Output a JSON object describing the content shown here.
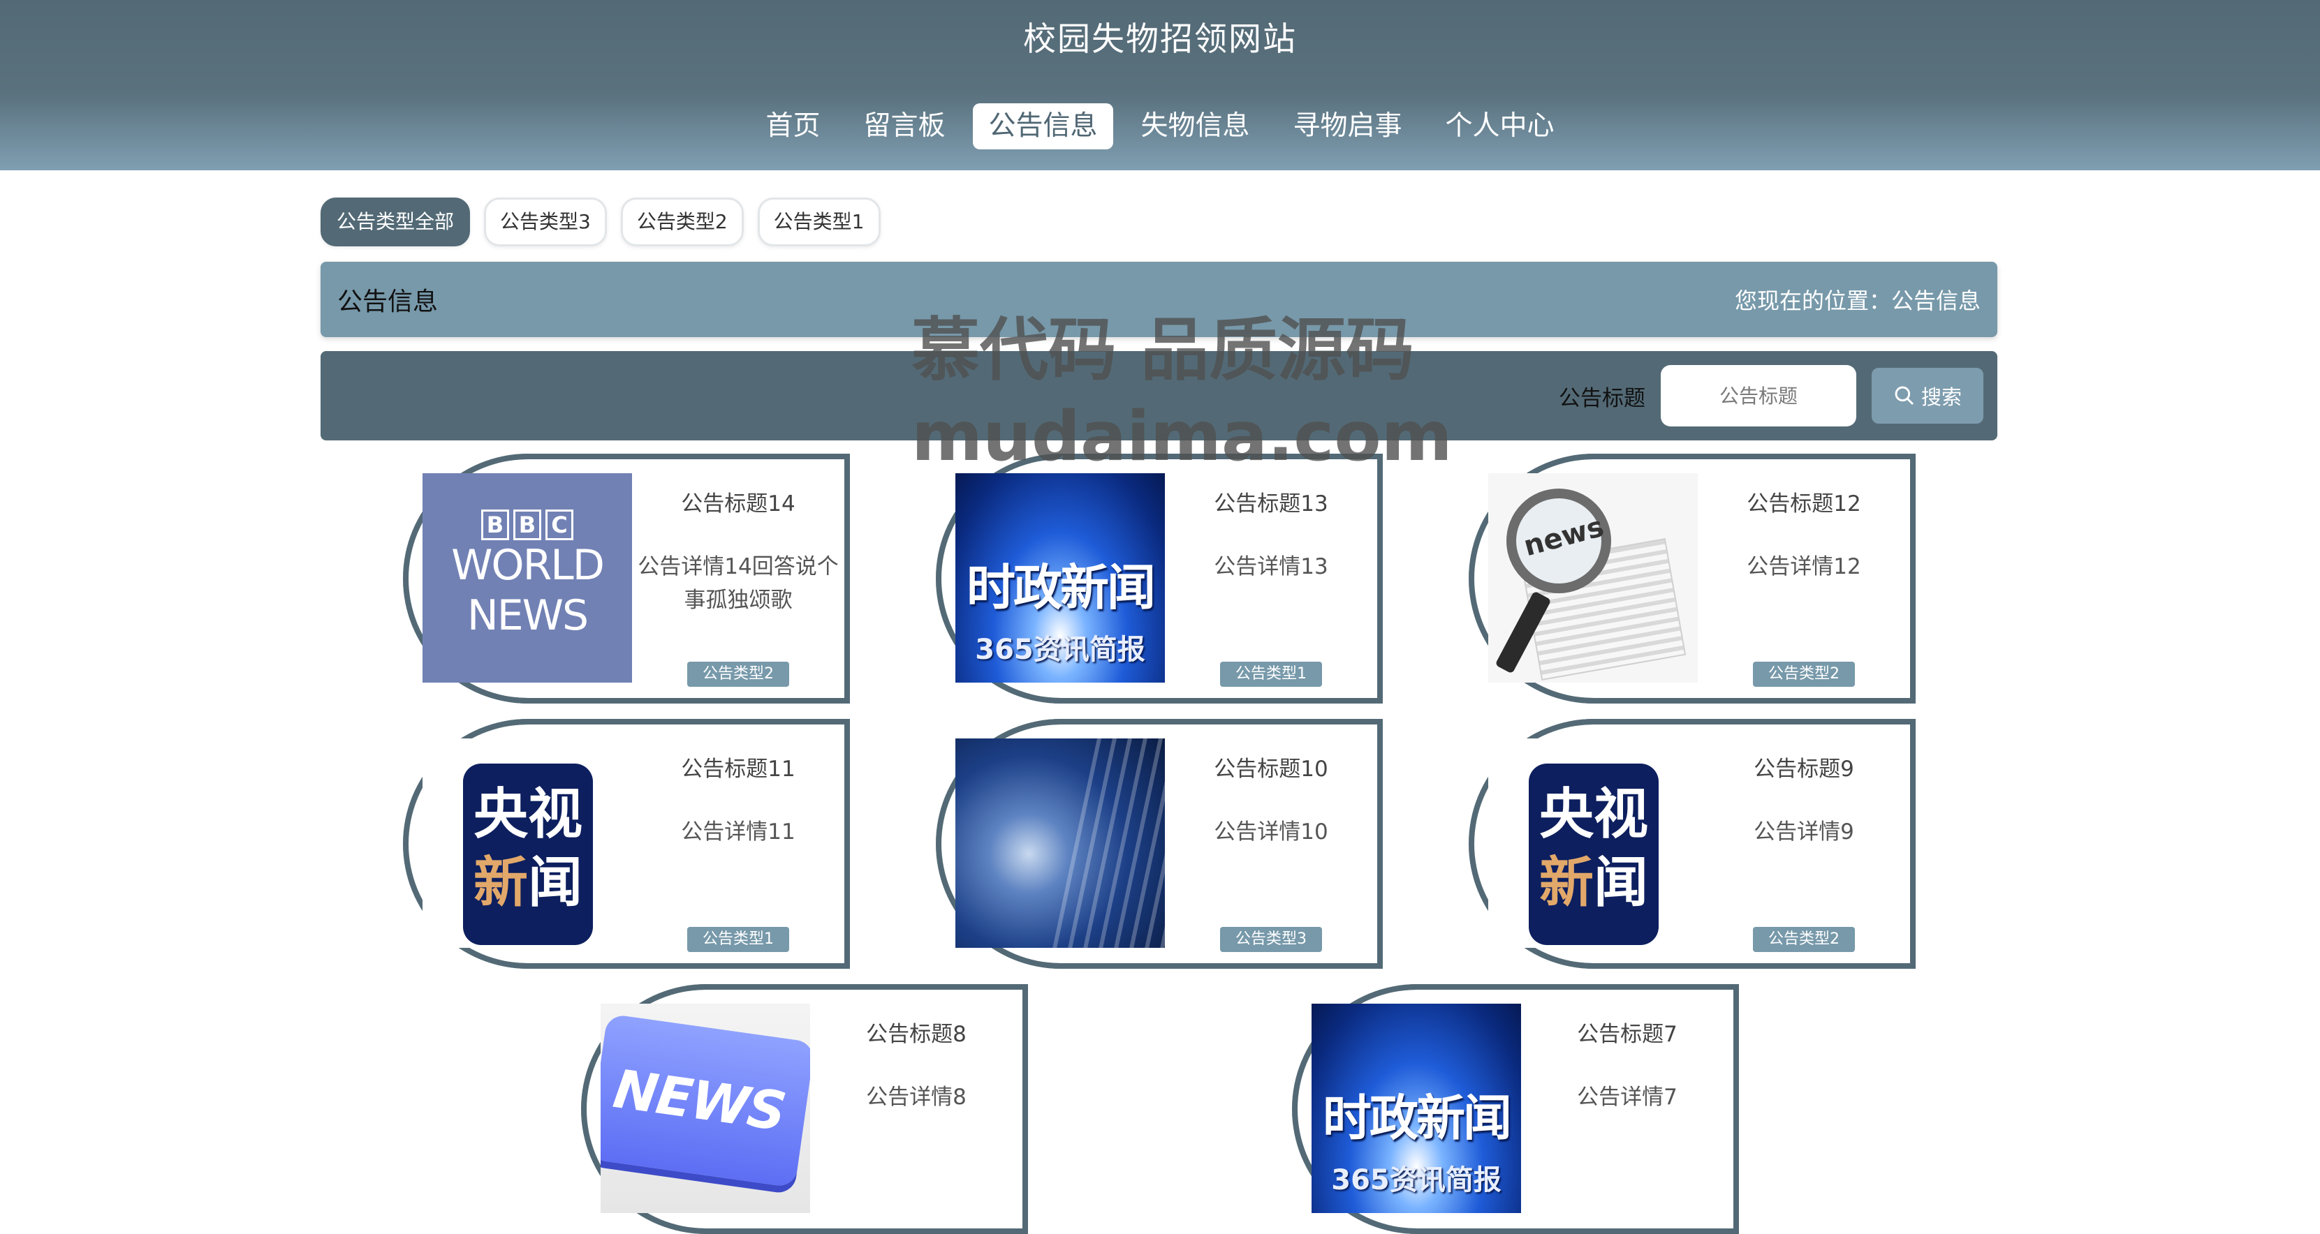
{
  "site": {
    "title": "校园失物招领网站"
  },
  "nav": [
    {
      "label": "首页"
    },
    {
      "label": "留言板"
    },
    {
      "label": "公告信息",
      "active": true
    },
    {
      "label": "失物信息"
    },
    {
      "label": "寻物启事"
    },
    {
      "label": "个人中心"
    }
  ],
  "filters": [
    {
      "label": "公告类型全部",
      "active": true
    },
    {
      "label": "公告类型3"
    },
    {
      "label": "公告类型2"
    },
    {
      "label": "公告类型1"
    }
  ],
  "breadcrumb": {
    "title": "公告信息",
    "location": "您现在的位置：公告信息"
  },
  "search": {
    "label": "公告标题",
    "placeholder": "公告标题",
    "button_label": "搜索"
  },
  "cards": [
    {
      "title": "公告标题14",
      "detail": "公告详情14回答说个事孤独颂歌",
      "type": "公告类型2",
      "image": "bbc-world-news"
    },
    {
      "title": "公告标题13",
      "detail": "公告详情13",
      "type": "公告类型1",
      "image": "shizheng-xinwen"
    },
    {
      "title": "公告标题12",
      "detail": "公告详情12",
      "type": "公告类型2",
      "image": "newspaper-magnifier"
    },
    {
      "title": "公告标题11",
      "detail": "公告详情11",
      "type": "公告类型1",
      "image": "cctv-news"
    },
    {
      "title": "公告标题10",
      "detail": "公告详情10",
      "type": "公告类型3",
      "image": "globe"
    },
    {
      "title": "公告标题9",
      "detail": "公告详情9",
      "type": "公告类型2",
      "image": "cctv-news"
    },
    {
      "title": "公告标题8",
      "detail": "公告详情8",
      "type": "",
      "image": "news-key"
    },
    {
      "title": "公告标题7",
      "detail": "公告详情7",
      "type": "",
      "image": "shizheng-xinwen"
    }
  ],
  "images": {
    "bbc": {
      "letters": [
        "B",
        "B",
        "C"
      ],
      "line1": "WORLD",
      "line2": "NEWS"
    },
    "shizheng": {
      "big": "时政新闻",
      "small": "365资讯简报"
    },
    "cctv": {
      "top": "央视",
      "bottom1": "新",
      "bottom2": "闻"
    },
    "paper": {
      "word": "news"
    },
    "keys": {
      "word": "NEWS"
    }
  },
  "watermark": {
    "line1": "慕代码 品质源码",
    "line2": "mudaima.com"
  },
  "colors": {
    "header": "#536a76",
    "accent": "#7799aa",
    "card_border": "#536a76"
  }
}
